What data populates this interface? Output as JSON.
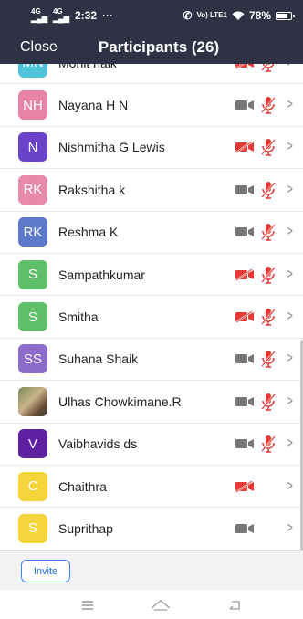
{
  "status_bar": {
    "signal_1": "4G",
    "signal_2": "4G",
    "time": "2:32",
    "more": "···",
    "volte": "Vo) LTE1",
    "battery": "78%"
  },
  "header": {
    "close_label": "Close",
    "title": "Participants (26)"
  },
  "participants": [
    {
      "initials": "MN",
      "name": "Mohit naik",
      "avatar_color": "#4fc3d9",
      "video": "off",
      "mic": "muted"
    },
    {
      "initials": "NH",
      "name": "Nayana H N",
      "avatar_color": "#e784a6",
      "video": "on",
      "mic": "muted"
    },
    {
      "initials": "N",
      "name": "Nishmitha G Lewis",
      "avatar_color": "#6a43c8",
      "video": "off",
      "mic": "muted"
    },
    {
      "initials": "RK",
      "name": "Rakshitha k",
      "avatar_color": "#e78aa8",
      "video": "on",
      "mic": "muted"
    },
    {
      "initials": "RK",
      "name": "Reshma K",
      "avatar_color": "#5b7ac9",
      "video": "on",
      "mic": "muted"
    },
    {
      "initials": "S",
      "name": "Sampathkumar",
      "avatar_color": "#5fbf6a",
      "video": "off",
      "mic": "muted"
    },
    {
      "initials": "S",
      "name": "Smitha",
      "avatar_color": "#5fbf6a",
      "video": "off",
      "mic": "muted"
    },
    {
      "initials": "SS",
      "name": "Suhana Shaik",
      "avatar_color": "#8c6cc8",
      "video": "on",
      "mic": "muted"
    },
    {
      "initials": "",
      "name": "Ulhas Chowkimane.R",
      "avatar_color": "#7a8a5a",
      "video": "on",
      "mic": "muted",
      "photo": true
    },
    {
      "initials": "V",
      "name": "Vaibhavids ds",
      "avatar_color": "#5e1fa0",
      "video": "on",
      "mic": "muted"
    },
    {
      "initials": "C",
      "name": "Chaithra",
      "avatar_color": "#f5d43c",
      "video": "off",
      "mic": "none"
    },
    {
      "initials": "S",
      "name": "Suprithap",
      "avatar_color": "#f5d43c",
      "video": "on",
      "mic": "none"
    }
  ],
  "footer": {
    "invite_label": "Invite"
  },
  "nav": {
    "menu": "menu-icon",
    "home": "home-icon",
    "back": "back-icon"
  },
  "colors": {
    "header_bg": "#2f3244",
    "muted_red": "#e53935",
    "icon_gray": "#777777",
    "invite_blue": "#1f6fd8"
  }
}
